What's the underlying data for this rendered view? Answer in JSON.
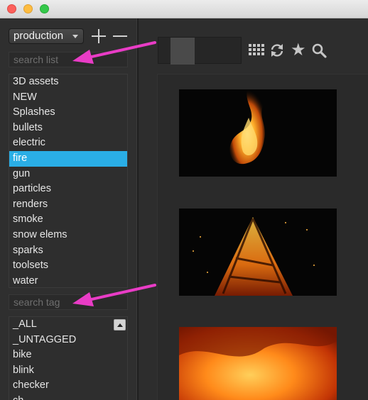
{
  "window": {
    "controls": [
      "close",
      "minimize",
      "maximize"
    ]
  },
  "sidebar": {
    "project_select": {
      "value": "production"
    },
    "search_list": {
      "placeholder": "search list"
    },
    "lists": [
      {
        "label": "3D assets",
        "selected": false
      },
      {
        "label": "NEW",
        "selected": false
      },
      {
        "label": "Splashes",
        "selected": false
      },
      {
        "label": "bullets",
        "selected": false
      },
      {
        "label": "electric",
        "selected": false
      },
      {
        "label": "fire",
        "selected": true
      },
      {
        "label": "gun",
        "selected": false
      },
      {
        "label": "particles",
        "selected": false
      },
      {
        "label": "renders",
        "selected": false
      },
      {
        "label": "smoke",
        "selected": false
      },
      {
        "label": "snow elems",
        "selected": false
      },
      {
        "label": "sparks",
        "selected": false
      },
      {
        "label": "toolsets",
        "selected": false
      },
      {
        "label": "water",
        "selected": false
      }
    ],
    "search_tag": {
      "placeholder": "search tag"
    },
    "tags": [
      {
        "label": "_ALL"
      },
      {
        "label": "_UNTAGGED"
      },
      {
        "label": "bike"
      },
      {
        "label": "blink"
      },
      {
        "label": "checker"
      },
      {
        "label": "ch..."
      }
    ]
  },
  "toolbar": {
    "icons": [
      "grid-icon",
      "refresh-icon",
      "star-icon",
      "magnifier-icon"
    ]
  },
  "colors": {
    "selection": "#2aaee6",
    "annotation_arrow": "#e93cc6"
  }
}
